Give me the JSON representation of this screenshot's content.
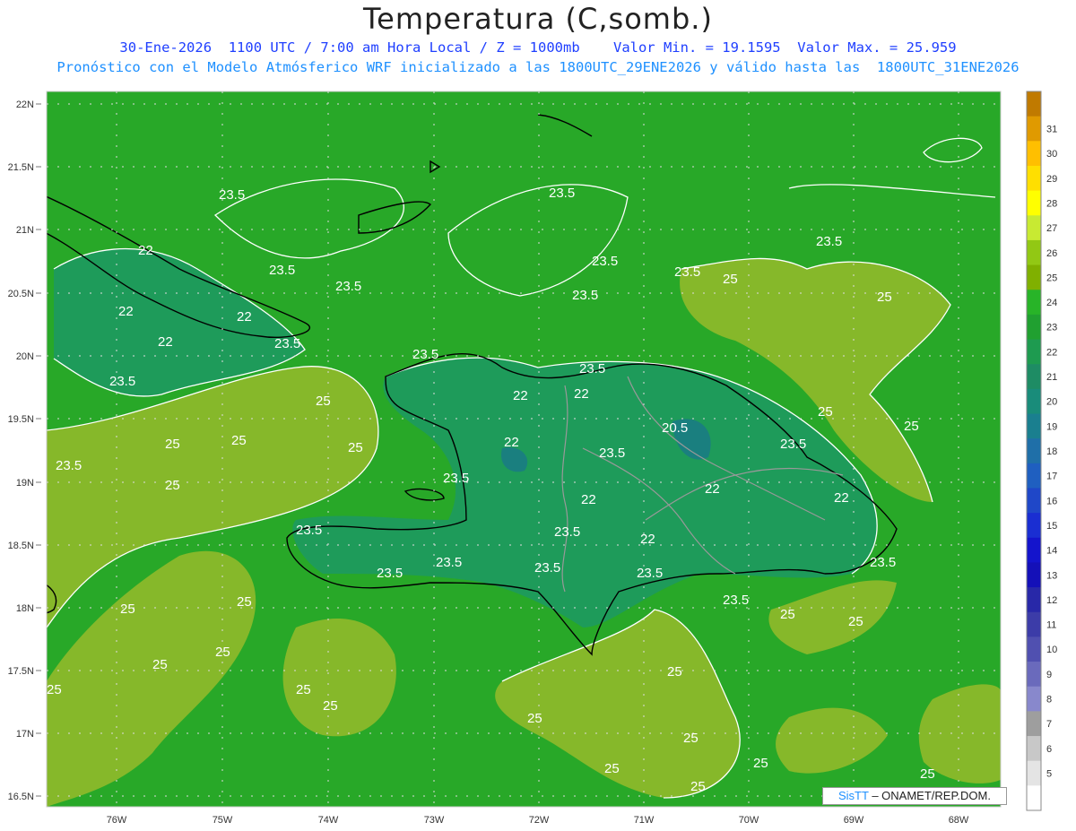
{
  "header": {
    "title": "Temperatura (C,somb.)",
    "line1": "30-Ene-2026  1100 UTC / 7:00 am Hora Local / Z = 1000mb    Valor Min. = 19.1595  Valor Max. = 25.959",
    "line2": "Pronóstico con el Modelo Atmósferico WRF inicializado a las 1800UTC_29ENE2026 y válido hasta las  1800UTC_31ENE2026"
  },
  "axes": {
    "lat_labels": [
      "22N",
      "21.5N",
      "21N",
      "20.5N",
      "20N",
      "19.5N",
      "19N",
      "18.5N",
      "18N",
      "17.5N",
      "17N",
      "16.5N"
    ],
    "lon_labels": [
      "76W",
      "75W",
      "74W",
      "73W",
      "72W",
      "71W",
      "70W",
      "69W",
      "68W"
    ]
  },
  "colorbar": {
    "labels": [
      "31",
      "30",
      "29",
      "28",
      "27",
      "26",
      "25",
      "24",
      "23",
      "22",
      "21",
      "20",
      "19",
      "18",
      "17",
      "16",
      "15",
      "14",
      "13",
      "12",
      "11",
      "10",
      "9",
      "8",
      "7",
      "6",
      "5"
    ],
    "colors": [
      "#c07a00",
      "#e09a00",
      "#ffbf00",
      "#ffdf00",
      "#ffff00",
      "#c8ea32",
      "#92c814",
      "#80b000",
      "#28b428",
      "#20a030",
      "#1e9b50",
      "#1e8c64",
      "#198c7a",
      "#1a7f8f",
      "#1f6fa8",
      "#1f5fc0",
      "#1f47c8",
      "#1a2ed2",
      "#1414cc",
      "#1410b8",
      "#2828a8",
      "#3c3ca8",
      "#5050b0",
      "#6a6abc",
      "#8888cc",
      "#9e9e9e",
      "#c8c8c8",
      "#e4e4e4",
      "#ffffff"
    ]
  },
  "map_colors": {
    "sea_base": "#28a828",
    "warm_25": "#86b82a",
    "cool_22": "#1e9b5a",
    "cool_20": "#1a7f7f",
    "contour": "#ffffff",
    "coast": "#000000",
    "border": "#999999"
  },
  "contour_labels": {
    "v235": "23.5",
    "v25": "25",
    "v22": "22",
    "v205": "20.5"
  },
  "credit": {
    "brand": "SisTT",
    "text": " – ONAMET/REP.DOM."
  }
}
